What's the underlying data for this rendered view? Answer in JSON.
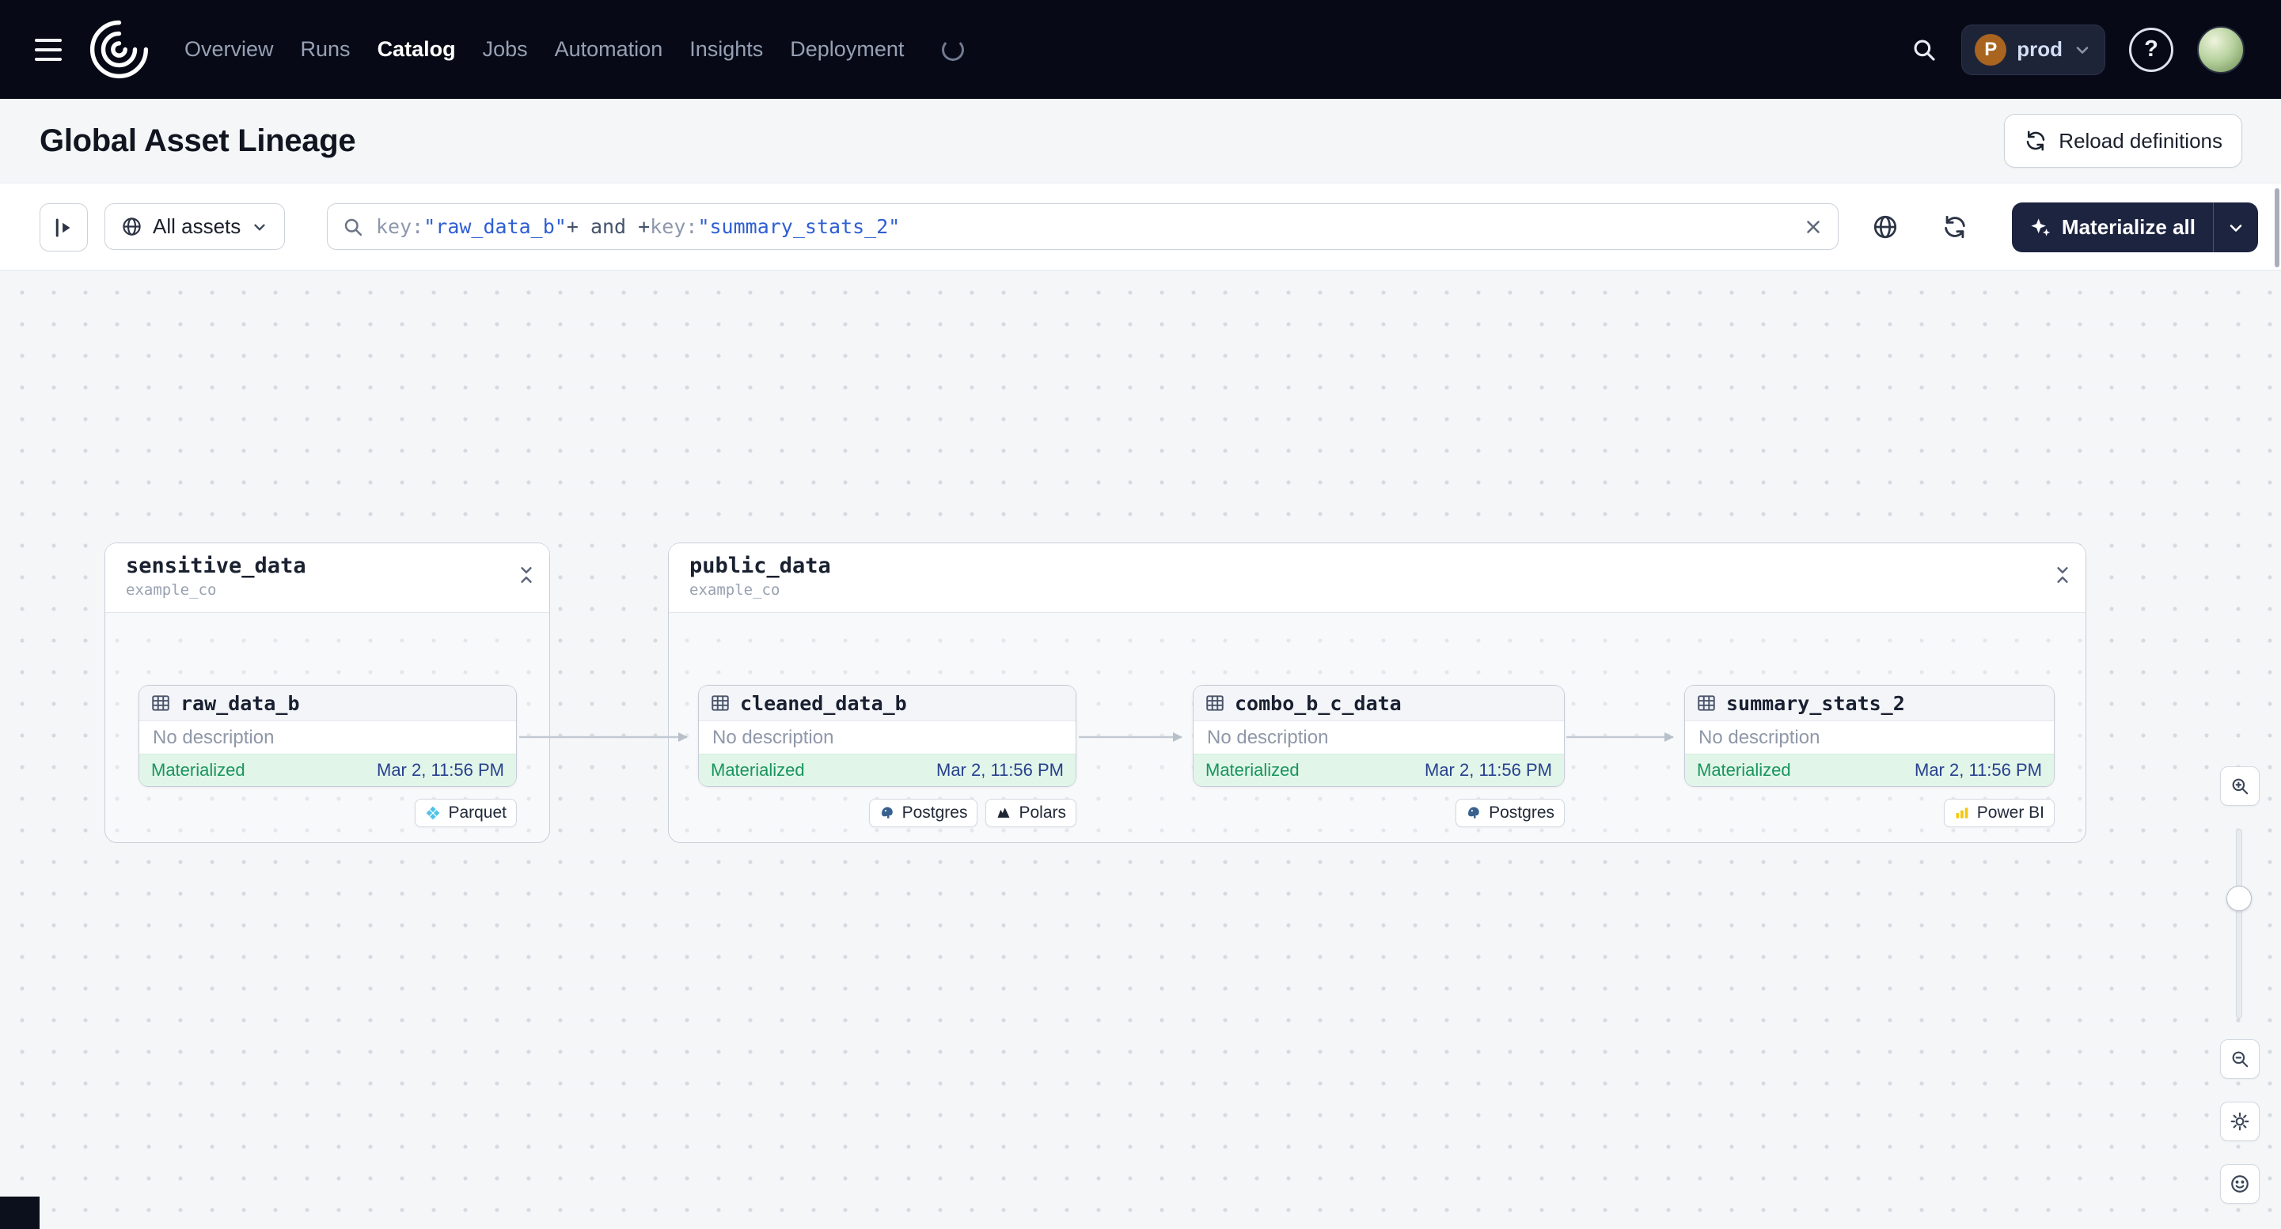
{
  "nav": {
    "items": [
      {
        "label": "Overview",
        "active": false
      },
      {
        "label": "Runs",
        "active": false
      },
      {
        "label": "Catalog",
        "active": true
      },
      {
        "label": "Jobs",
        "active": false
      },
      {
        "label": "Automation",
        "active": false
      },
      {
        "label": "Insights",
        "active": false
      },
      {
        "label": "Deployment",
        "active": false
      }
    ],
    "environment": {
      "avatar_letter": "P",
      "name": "prod"
    },
    "help_glyph": "?"
  },
  "header": {
    "title": "Global Asset Lineage",
    "reload_button_label": "Reload definitions"
  },
  "toolbar": {
    "scope_button_label": "All assets",
    "materialize_button_label": "Materialize all",
    "search_tokens": [
      {
        "text": "key:",
        "type": "key"
      },
      {
        "text": "\"raw_data_b\"",
        "type": "value"
      },
      {
        "text": "+ ",
        "type": "op"
      },
      {
        "text": "and ",
        "type": "op"
      },
      {
        "text": "+",
        "type": "op"
      },
      {
        "text": "key:",
        "type": "key"
      },
      {
        "text": "\"summary_stats_2\"",
        "type": "value"
      }
    ]
  },
  "graph": {
    "groups": [
      {
        "name": "sensitive_data",
        "location": "example_co"
      },
      {
        "name": "public_data",
        "location": "example_co"
      }
    ],
    "nodes": [
      {
        "name": "raw_data_b",
        "description": "No description",
        "status": "Materialized",
        "materialized_at": "Mar 2, 11:56 PM",
        "tags": [
          {
            "label": "Parquet",
            "icon": "parquet-icon"
          }
        ]
      },
      {
        "name": "cleaned_data_b",
        "description": "No description",
        "status": "Materialized",
        "materialized_at": "Mar 2, 11:56 PM",
        "tags": [
          {
            "label": "Postgres",
            "icon": "postgres-icon"
          },
          {
            "label": "Polars",
            "icon": "polars-icon"
          }
        ]
      },
      {
        "name": "combo_b_c_data",
        "description": "No description",
        "status": "Materialized",
        "materialized_at": "Mar 2, 11:56 PM",
        "tags": [
          {
            "label": "Postgres",
            "icon": "postgres-icon"
          }
        ]
      },
      {
        "name": "summary_stats_2",
        "description": "No description",
        "status": "Materialized",
        "materialized_at": "Mar 2, 11:56 PM",
        "tags": [
          {
            "label": "Power BI",
            "icon": "powerbi-icon"
          }
        ]
      }
    ]
  },
  "colors": {
    "nav_bg": "#070a16",
    "materialize_bg": "#1d2440",
    "status_green": "#18955c",
    "badge_bg": "#e2f5e9",
    "timestamp_blue": "#27418f",
    "search_value_blue": "#2e5fd3"
  }
}
